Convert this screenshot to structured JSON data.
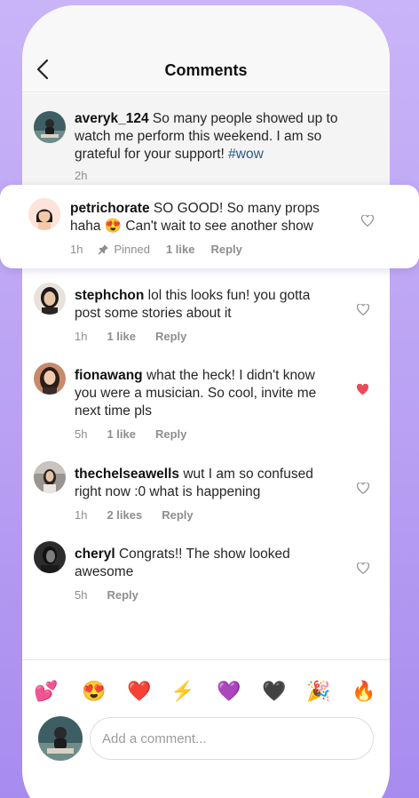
{
  "header": {
    "title": "Comments"
  },
  "caption": {
    "username": "averyk_124",
    "text": " So many people showed up to watch me perform this weekend. I am so grateful for your support! ",
    "hashtag": "#wow",
    "time": "2h"
  },
  "pinned": {
    "username": "petrichorate",
    "text_before": " SO GOOD! So many props haha ",
    "emoji": "😍",
    "text_after": " Can't wait to see another show",
    "time": "1h",
    "pinned_label": "Pinned",
    "likes": "1 like",
    "reply": "Reply"
  },
  "comments": [
    {
      "username": "stephchon",
      "text": " lol this looks fun! you gotta post some stories about it",
      "time": "1h",
      "likes": "1 like",
      "reply": "Reply",
      "liked": false
    },
    {
      "username": "fionawang",
      "text": " what the heck! I didn't know you were a musician. So cool, invite me next time pls",
      "time": "5h",
      "likes": "1 like",
      "reply": "Reply",
      "liked": true
    },
    {
      "username": "thechelseawells",
      "text": " wut I am so confused right now :0 what is happening",
      "time": "1h",
      "likes": "2 likes",
      "reply": "Reply",
      "liked": false
    },
    {
      "username": "cheryl",
      "text": " Congrats!! The show looked awesome",
      "time": "5h",
      "likes": "",
      "reply": "Reply",
      "liked": false
    }
  ],
  "emoji_bar": [
    "💕",
    "😍",
    "❤️",
    "⚡",
    "💜",
    "🖤",
    "🎉",
    "🔥"
  ],
  "composer": {
    "placeholder": "Add a comment..."
  },
  "colors": {
    "liked_heart": "#ed4956",
    "hashtag": "#2b5a83",
    "background": "#b9a0f3"
  }
}
